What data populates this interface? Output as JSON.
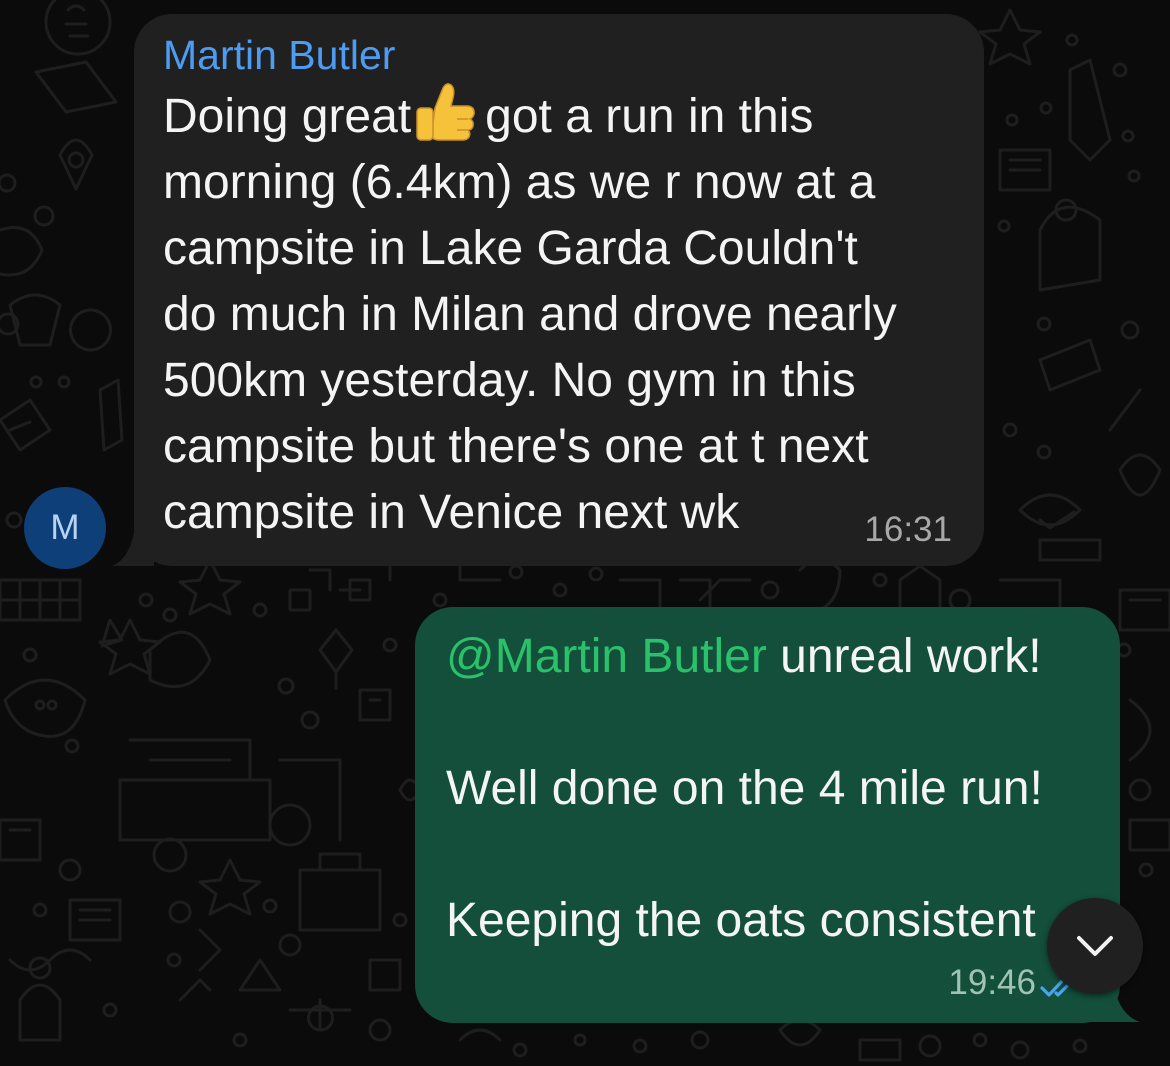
{
  "incoming_message": {
    "sender_name": "Martin Butler",
    "avatar_initial": "M",
    "lines": [
      {
        "before_emoji": "Doing great",
        "after_emoji": "got a run in this"
      },
      "morning (6.4km) as we r now at a",
      "campsite in Lake Garda Couldn't",
      "do much in Milan and drove nearly",
      "500km yesterday. No gym in this",
      "campsite but there's one at t next",
      "campsite in Venice next wk"
    ],
    "emoji": "thumbs-up",
    "time": "16:31"
  },
  "outgoing_message": {
    "mention": "@Martin Butler",
    "line1_rest": " unreal work!",
    "line2": "Well done on the 4 mile run!",
    "line3": "Keeping the oats consistent",
    "time": "19:46",
    "status_icon": "double-check-read-icon"
  },
  "scroll_button": {
    "icon": "chevron-down-icon"
  },
  "colors": {
    "background": "#0b0b0b",
    "incoming_bubble": "#202020",
    "outgoing_bubble": "#134f3a",
    "sender_name": "#4d9cf2",
    "mention": "#29c26a",
    "avatar": "#0f3f79",
    "read_ticks": "#4aa3f0"
  }
}
